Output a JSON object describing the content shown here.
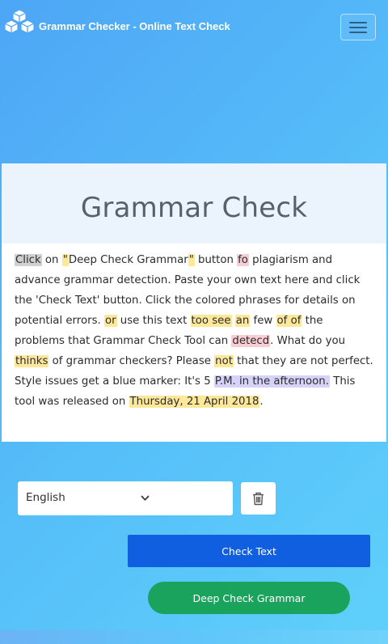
{
  "header": {
    "site_title": "Grammar Checker - Online Text Check",
    "logo_icon": "cubes-logo-icon",
    "menu_icon": "hamburger-menu-icon"
  },
  "card": {
    "title": "Grammar Check",
    "text_segments": [
      {
        "t": "Click",
        "mark": "gray"
      },
      {
        "t": " on ",
        "mark": ""
      },
      {
        "t": "\"",
        "mark": "yellow"
      },
      {
        "t": "Deep Check Grammar",
        "mark": ""
      },
      {
        "t": "\"",
        "mark": "yellow"
      },
      {
        "t": " button ",
        "mark": ""
      },
      {
        "t": "fo",
        "mark": "pink"
      },
      {
        "t": " plagiarism and advance grammar detection. Paste your own text here and click the 'Check Text' button. Click the colored phrases for details on potential errors. ",
        "mark": ""
      },
      {
        "t": "or",
        "mark": "yellow"
      },
      {
        "t": " use this text ",
        "mark": ""
      },
      {
        "t": "too see",
        "mark": "yellow"
      },
      {
        "t": " ",
        "mark": ""
      },
      {
        "t": "an",
        "mark": "yellow"
      },
      {
        "t": " few ",
        "mark": ""
      },
      {
        "t": "of of",
        "mark": "yellow"
      },
      {
        "t": " the problems that Grammar Check Tool can ",
        "mark": ""
      },
      {
        "t": "detecd",
        "mark": "pink"
      },
      {
        "t": ". What do you ",
        "mark": ""
      },
      {
        "t": "thinks",
        "mark": "yellow"
      },
      {
        "t": " of grammar checkers? Please ",
        "mark": ""
      },
      {
        "t": "not",
        "mark": "yellow"
      },
      {
        "t": " that they are not perfect. Style issues get a blue marker: It's 5 ",
        "mark": ""
      },
      {
        "t": "P.M. in the afternoon.",
        "mark": "blue"
      },
      {
        "t": " This tool was released on ",
        "mark": ""
      },
      {
        "t": "Thursday, 21 April 2018",
        "mark": "yellow"
      },
      {
        "t": ".",
        "mark": ""
      }
    ]
  },
  "controls": {
    "language_selected": "English",
    "dropdown_icon": "chevron-down-icon",
    "clear_icon": "trash-icon",
    "check_text_label": "Check Text",
    "deep_check_label": "Deep Check Grammar"
  },
  "colors": {
    "check_button": "#0f5fe0",
    "deep_button": "#1aa35c",
    "marker_yellow": "#fde89a",
    "marker_pink": "#f9cdd4",
    "marker_blue": "#d6d3fb",
    "marker_gray": "#d0d0d0"
  }
}
